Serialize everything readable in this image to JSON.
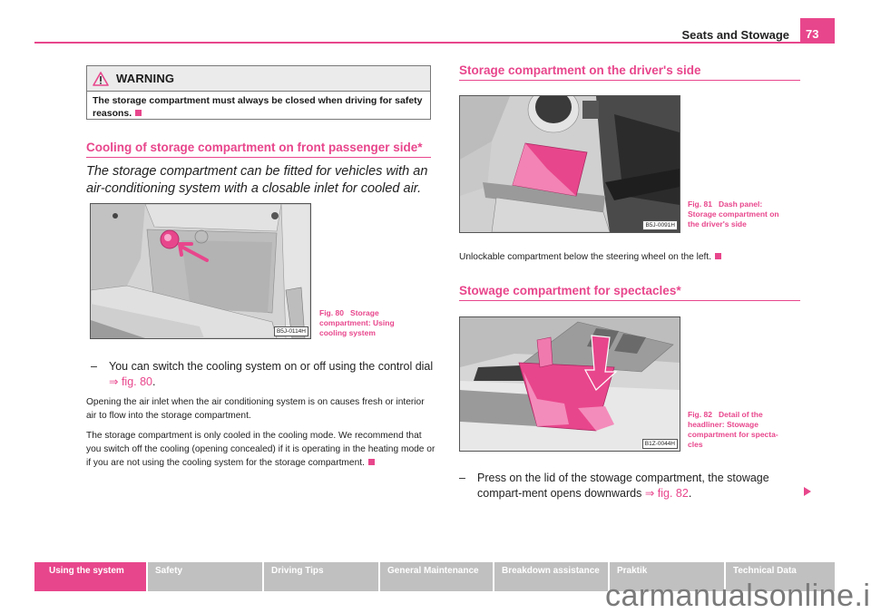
{
  "header": {
    "section_title": "Seats and Stowage",
    "page_number": "73",
    "accent_color": "#e8468c"
  },
  "left_column": {
    "warning": {
      "icon": "warning-triangle-icon",
      "title": "WARNING",
      "text": "The storage compartment must always be closed when driving for safety reasons."
    },
    "section": {
      "heading": "Cooling of storage compartment on front passenger side*",
      "intro": "The storage compartment can be fitted for vehicles with an air-conditioning system with a closable inlet for cooled air.",
      "figure": {
        "code": "B5J-0114H",
        "caption_label": "Fig. 80",
        "caption_text": "Storage compartment: Using cooling system"
      },
      "step": {
        "dash": "–",
        "text": "You can switch the cooling system on or off using the control dial",
        "ref": "⇒ fig. 80",
        "end": "."
      },
      "paragraphs": [
        "Opening the air inlet when the air conditioning system is on causes fresh or interior air to flow into the storage compartment.",
        "The storage compartment is only cooled in the cooling mode. We recommend that you switch off the cooling (opening concealed) if it is operating in the heating mode or if you are not using the cooling system for the storage compartment."
      ]
    }
  },
  "right_column": {
    "section1": {
      "heading": "Storage compartment on the driver's side",
      "figure": {
        "code": "B5J-0091H",
        "caption_label": "Fig. 81",
        "caption_text": "Dash panel: Storage compartment on the driver's side"
      },
      "paragraph": "Unlockable compartment below the steering wheel on the left."
    },
    "section2": {
      "heading": "Stowage compartment for spectacles*",
      "figure": {
        "code": "B1Z-0044H",
        "caption_label": "Fig. 82",
        "caption_text": "Detail of the headliner: Stowage compartment for specta-cles"
      },
      "step": {
        "dash": "–",
        "text": "Press on the lid of the stowage compartment, the stowage compart-ment opens downwards",
        "ref": "⇒ fig. 82",
        "end": "."
      }
    }
  },
  "footer_nav": {
    "tabs": [
      {
        "label": "Using the system",
        "active": true
      },
      {
        "label": "Safety",
        "active": false
      },
      {
        "label": "Driving Tips",
        "active": false
      },
      {
        "label": "General Maintenance",
        "active": false
      },
      {
        "label": "Breakdown assistance",
        "active": false
      },
      {
        "label": "Praktik",
        "active": false
      },
      {
        "label": "Technical Data",
        "active": false
      }
    ],
    "next_page_icon": "next-page-arrow-icon"
  },
  "watermark": "carmanualsonline.info"
}
